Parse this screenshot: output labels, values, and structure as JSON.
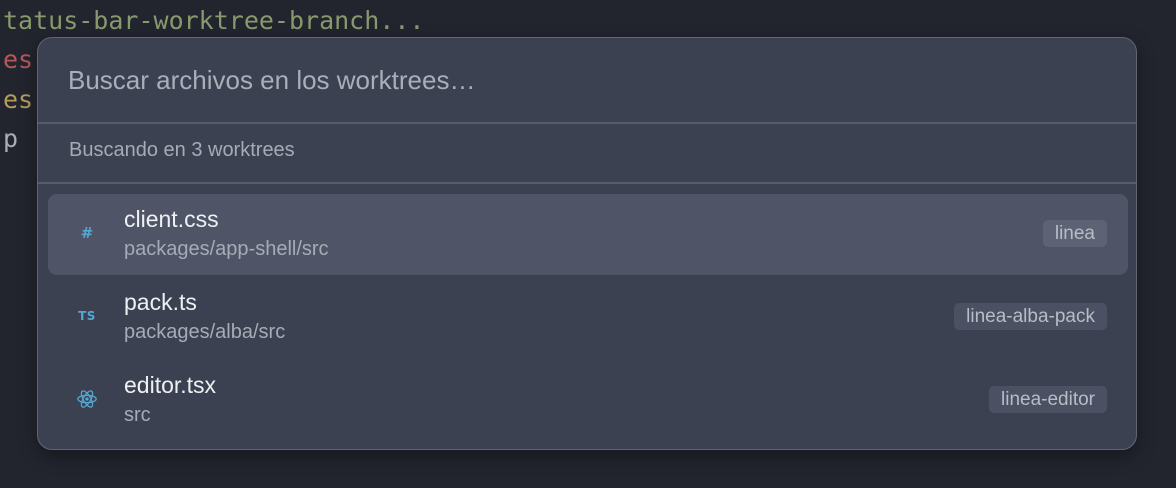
{
  "editor": {
    "lines": [
      "tatus-bar-worktree-branch...",
      "es",
      "es",
      "p"
    ]
  },
  "palette": {
    "search": {
      "placeholder": "Buscar archivos en los worktrees…",
      "value": ""
    },
    "status": "Buscando en 3 worktrees",
    "results": [
      {
        "icon": "css-hash-icon",
        "icon_glyph": "#",
        "name": "client.css",
        "path": "packages/app-shell/src",
        "worktree": "linea",
        "selected": true
      },
      {
        "icon": "typescript-icon",
        "icon_glyph": "TS",
        "name": "pack.ts",
        "path": "packages/alba/src",
        "worktree": "linea-alba-pack",
        "selected": false
      },
      {
        "icon": "react-icon",
        "icon_glyph": "",
        "name": "editor.tsx",
        "path": "src",
        "worktree": "linea-editor",
        "selected": false
      }
    ]
  },
  "colors": {
    "accent_icon": "#56a6d3",
    "palette_bg": "#3b4150",
    "selected_bg": "#4f5566"
  }
}
